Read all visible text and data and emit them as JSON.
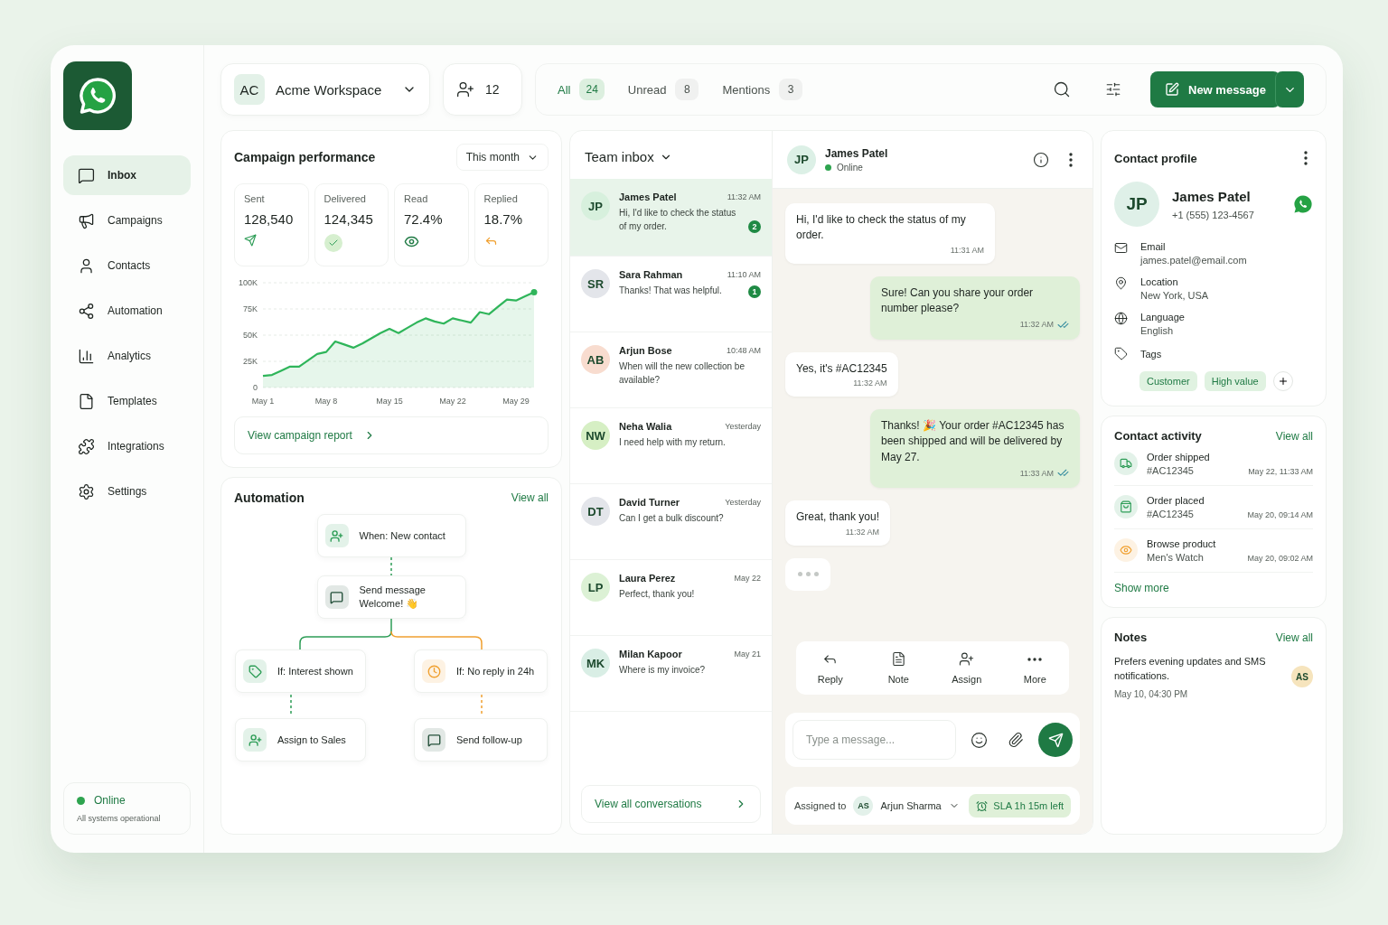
{
  "sidebar": {
    "items": [
      {
        "label": "Inbox",
        "selected": true
      },
      {
        "label": "Campaigns",
        "selected": false
      },
      {
        "label": "Contacts",
        "selected": false
      },
      {
        "label": "Automation",
        "selected": false
      },
      {
        "label": "Analytics",
        "selected": false
      },
      {
        "label": "Templates",
        "selected": false
      },
      {
        "label": "Integrations",
        "selected": false
      },
      {
        "label": "Settings",
        "selected": false
      }
    ],
    "status": {
      "label": "Online",
      "detail": "All systems operational"
    }
  },
  "workspace": {
    "initials": "AC",
    "name": "Acme Workspace"
  },
  "members": {
    "count": "12"
  },
  "filters": [
    {
      "label": "All",
      "count": "24",
      "selected": true
    },
    {
      "label": "Unread",
      "count": "8",
      "selected": false
    },
    {
      "label": "Mentions",
      "count": "3",
      "selected": false
    }
  ],
  "new_message_button": "New message",
  "campaign": {
    "title": "Campaign performance",
    "period": "This month",
    "stats": [
      {
        "label": "Sent",
        "value": "128,540",
        "color": "#2e9d57"
      },
      {
        "label": "Delivered",
        "value": "124,345",
        "color": "#2e9d57"
      },
      {
        "label": "Read",
        "value": "72.4%",
        "color": "#1f7a44"
      },
      {
        "label": "Replied",
        "value": "18.7%",
        "color": "#f0a030"
      }
    ],
    "chart_data": {
      "type": "area",
      "categories": [
        "May 1",
        null,
        null,
        null,
        null,
        null,
        null,
        "May 8",
        null,
        null,
        null,
        null,
        null,
        null,
        "May 15",
        null,
        null,
        null,
        null,
        null,
        null,
        "May 22",
        null,
        null,
        null,
        null,
        null,
        null,
        "May 29",
        null,
        null
      ],
      "values": [
        11000,
        12000,
        16000,
        20000,
        20000,
        26000,
        32000,
        34000,
        44000,
        41000,
        38000,
        42000,
        47000,
        52000,
        56000,
        52000,
        57000,
        62000,
        66000,
        63000,
        61000,
        66000,
        64000,
        62000,
        72000,
        70000,
        77000,
        84000,
        83000,
        87000,
        91000
      ],
      "ylim": [
        0,
        100000
      ],
      "grid": true,
      "yticks": [
        {
          "value": 0,
          "label": "0"
        },
        {
          "value": 25000,
          "label": "25K"
        },
        {
          "value": 50000,
          "label": "50K"
        },
        {
          "value": 75000,
          "label": "75K"
        },
        {
          "value": 100000,
          "label": "100K"
        }
      ]
    },
    "link": "View campaign report"
  },
  "automation": {
    "title": "Automation",
    "link": "View all",
    "nodes": [
      {
        "label": "When: New contact",
        "color": "#2e9d57"
      },
      {
        "label": "Send message",
        "detail": "Welcome! 👋",
        "color": "#24503a"
      },
      {
        "label": "If: Interest shown",
        "color": "#2e9d57"
      },
      {
        "label": "If: No reply in 24h",
        "color": "#f0a030"
      },
      {
        "label": "Assign to Sales",
        "color": "#2e9d57"
      },
      {
        "label": "Send follow-up",
        "color": "#24503a"
      }
    ]
  },
  "inbox": {
    "title": "Team inbox",
    "conversations": [
      {
        "initials": "JP",
        "name": "James Patel",
        "time": "11:32 AM",
        "preview": "Hi, I'd like to check the status of my order.",
        "unread": "2",
        "selected": true,
        "color": "#d7f0dd"
      },
      {
        "initials": "SR",
        "name": "Sara Rahman",
        "time": "11:10 AM",
        "preview": "Thanks! That was helpful.",
        "unread": "1",
        "selected": false,
        "color": "#e3e5ea"
      },
      {
        "initials": "AB",
        "name": "Arjun Bose",
        "time": "10:48 AM",
        "preview": "When will the new collection be available?",
        "selected": false,
        "color": "#f8dccf"
      },
      {
        "initials": "NW",
        "name": "Neha Walia",
        "time": "Yesterday",
        "preview": "I need help with my return.",
        "selected": false,
        "color": "#d6efc4"
      },
      {
        "initials": "DT",
        "name": "David Turner",
        "time": "Yesterday",
        "preview": "Can I get a bulk discount?",
        "selected": false,
        "color": "#e3e5ea"
      },
      {
        "initials": "LP",
        "name": "Laura Perez",
        "time": "May 22",
        "preview": "Perfect, thank you!",
        "selected": false,
        "color": "#dcf1d5"
      },
      {
        "initials": "MK",
        "name": "Milan Kapoor",
        "time": "May 21",
        "preview": "Where is my invoice?",
        "selected": false,
        "color": "#d9eee5"
      }
    ],
    "link": "View all conversations"
  },
  "chat": {
    "contact": {
      "initials": "JP",
      "name": "James Patel",
      "status": "Online"
    },
    "messages": [
      {
        "kind": "incoming",
        "text": "Hi, I'd like to check the status of my order.",
        "time": "11:31 AM",
        "read": false
      },
      {
        "kind": "outgoing",
        "text": "Sure! Can you share your order number please?",
        "time": "11:32 AM",
        "read": true
      },
      {
        "kind": "incoming",
        "text": "Yes, it's #AC12345",
        "time": "11:32 AM",
        "read": false
      },
      {
        "kind": "outgoing",
        "text": "Thanks! 🎉 Your order #AC12345 has been shipped and will be delivered by May 27.",
        "time": "11:33 AM",
        "read": true
      },
      {
        "kind": "incoming",
        "text": "Great, thank you!",
        "time": "11:32 AM",
        "read": false
      }
    ],
    "typing": true,
    "actions": [
      "Reply",
      "Note",
      "Assign",
      "More"
    ],
    "composer": {
      "placeholder": "Type a message..."
    },
    "assigned_label": "Assigned to",
    "assignee": {
      "initials": "AS",
      "name": "Arjun Sharma"
    },
    "sla": "SLA 1h 15m left"
  },
  "profile": {
    "title": "Contact profile",
    "initials": "JP",
    "name": "James Patel",
    "phone": "+1 (555) 123-4567",
    "fields": [
      {
        "label": "Email",
        "value": "james.patel@email.com"
      },
      {
        "label": "Location",
        "value": "New York, USA"
      },
      {
        "label": "Language",
        "value": "English"
      }
    ],
    "tags_label": "Tags",
    "tags": [
      "Customer",
      "High value"
    ]
  },
  "activity": {
    "title": "Contact activity",
    "link": "View all",
    "items": [
      {
        "title": "Order shipped",
        "detail": "#AC12345",
        "time": "May 22, 11:33 AM",
        "color": "#2e9d57"
      },
      {
        "title": "Order placed",
        "detail": "#AC12345",
        "time": "May 20, 09:14 AM",
        "color": "#2e9d57"
      },
      {
        "title": "Browse product",
        "detail": "Men's Watch",
        "time": "May 20, 09:02 AM",
        "color": "#f0a030"
      }
    ],
    "more": "Show more"
  },
  "notes": {
    "title": "Notes",
    "link": "View all",
    "text": "Prefers evening updates and SMS notifications.",
    "date": "May 10, 04:30 PM",
    "author_initials": "AS"
  }
}
